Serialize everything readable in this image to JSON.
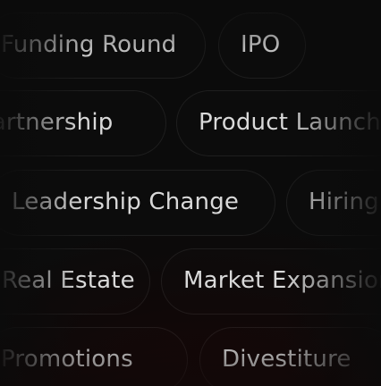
{
  "tags": {
    "row1": [
      "Funding Round",
      "IPO"
    ],
    "row2": [
      "Partnership",
      "Product Launch"
    ],
    "row3": [
      "Leadership Change",
      "Hiring"
    ],
    "row4": [
      "Real Estate",
      "Market Expansion"
    ],
    "row5": [
      "Promotions",
      "Divestiture"
    ]
  }
}
